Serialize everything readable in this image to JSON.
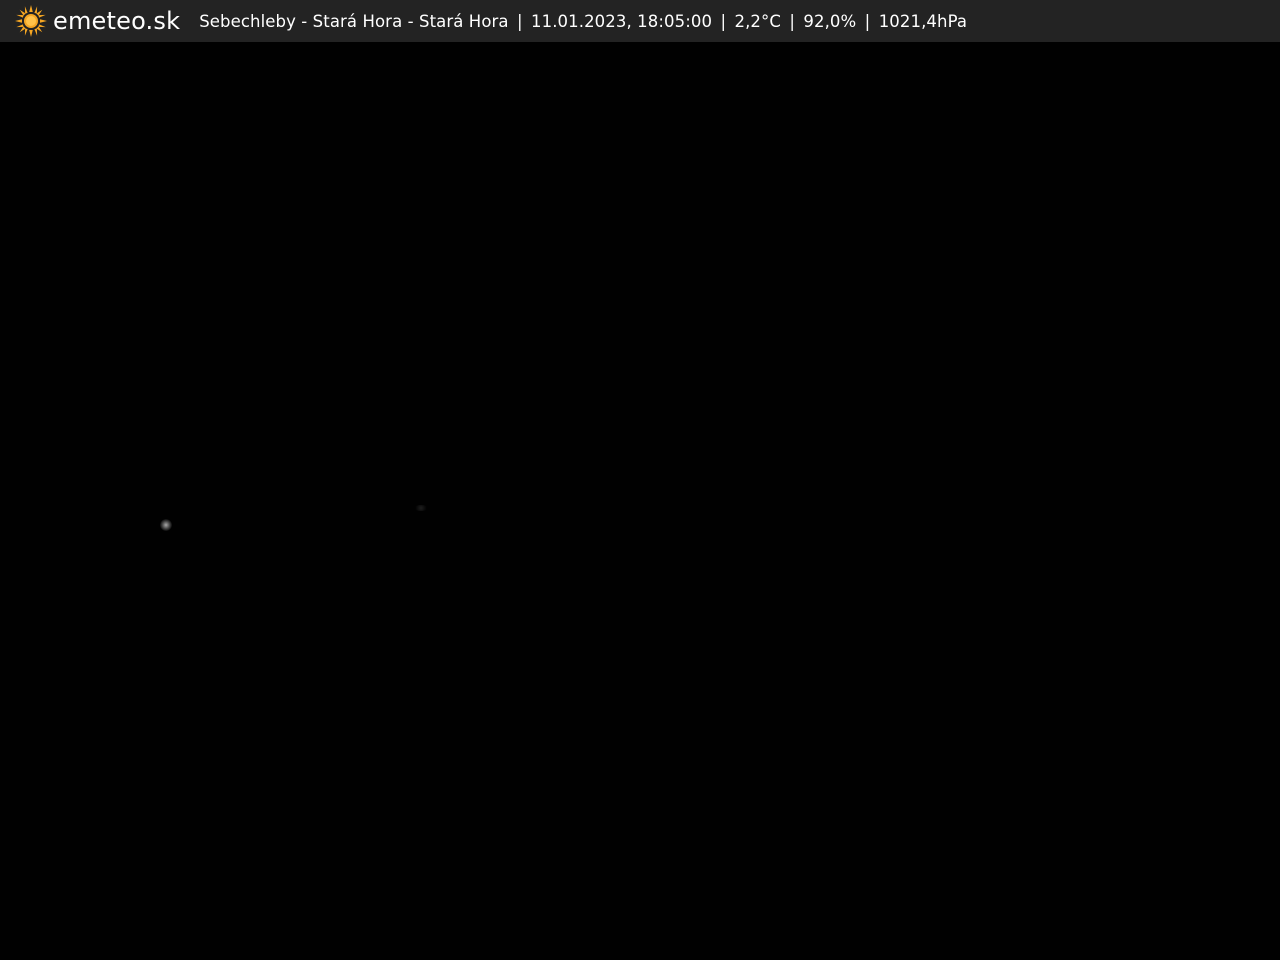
{
  "header": {
    "brand": "emeteo.sk",
    "location": "Sebechleby - Stará Hora - Stará Hora",
    "datetime": "11.01.2023, 18:05:00",
    "temperature": "2,2°C",
    "humidity": "92,0%",
    "pressure": "1021,4hPa",
    "separator": "|"
  },
  "icons": {
    "logo": "sun-icon"
  },
  "colors": {
    "header_bg": "#232323",
    "header_text": "#ffffff",
    "sun": "#f5a623",
    "camera_bg": "#010101"
  }
}
